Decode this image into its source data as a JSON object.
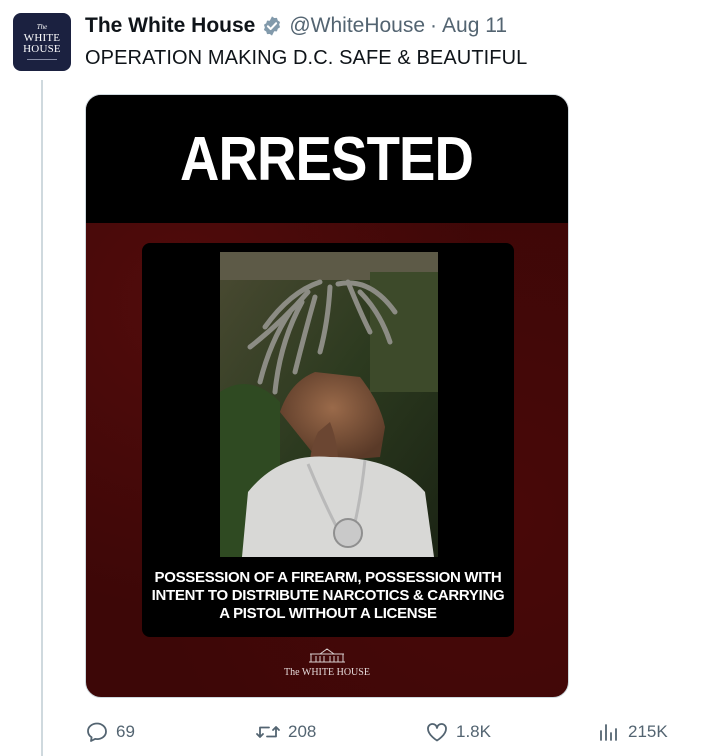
{
  "avatar": {
    "line1": "The",
    "line2": "WHITE",
    "line3": "HOUSE"
  },
  "author": {
    "display_name": "The White House",
    "handle": "@WhiteHouse",
    "separator": "·",
    "date": "Aug 11",
    "verified_icon": "verified-badge-icon"
  },
  "tweet": {
    "text": "OPERATION MAKING D.C. SAFE & BEAUTIFUL"
  },
  "media": {
    "banner": "ARRESTED",
    "charges": [
      "POSSESSION OF A FIREARM,  POSSESSION WITH",
      "INTENT TO DISTRIBUTE NARCOTICS & CARRYING",
      "A PISTOL WITHOUT A LICENSE"
    ],
    "footer_wordmark": "The WHITE HOUSE",
    "colors": {
      "banner": "#000000",
      "background": "#3d0707"
    }
  },
  "actions": {
    "replies": {
      "icon": "reply-icon",
      "count": "69"
    },
    "reposts": {
      "icon": "repost-icon",
      "count": "208"
    },
    "likes": {
      "icon": "heart-icon",
      "count": "1.8K"
    },
    "views": {
      "icon": "views-icon",
      "count": "215K"
    }
  },
  "colors": {
    "muted": "#536471",
    "verified": "#829aab",
    "text": "#0f1419"
  }
}
